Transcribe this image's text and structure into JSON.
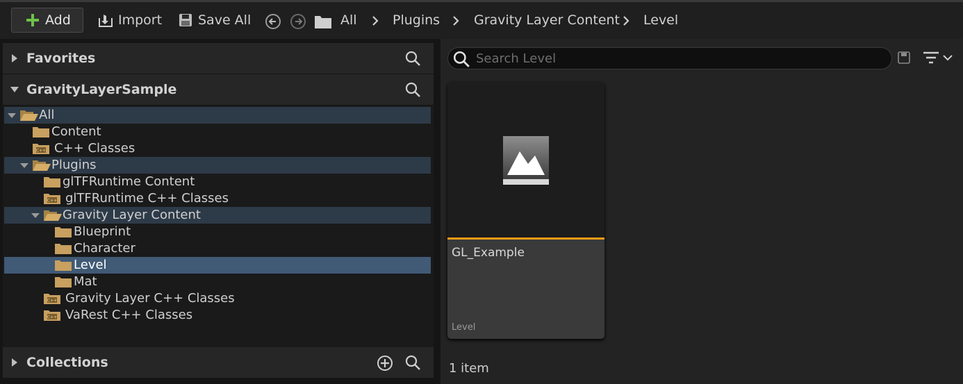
{
  "toolbar": {
    "add_label": "Add",
    "import_label": "Import",
    "save_all_label": "Save All",
    "breadcrumb": [
      "All",
      "Plugins",
      "Gravity Layer Content",
      "Level"
    ]
  },
  "left": {
    "favorites_title": "Favorites",
    "project_title": "GravityLayerSample",
    "collections_title": "Collections",
    "tree": [
      {
        "label": "All",
        "type": "open"
      },
      {
        "label": "Content",
        "type": "folder"
      },
      {
        "label": "C++ Classes",
        "type": "cpp"
      },
      {
        "label": "Plugins",
        "type": "open"
      },
      {
        "label": "glTFRuntime Content",
        "type": "folder"
      },
      {
        "label": "glTFRuntime C++ Classes",
        "type": "cpp"
      },
      {
        "label": "Gravity Layer Content",
        "type": "open"
      },
      {
        "label": "Blueprint",
        "type": "folder"
      },
      {
        "label": "Character",
        "type": "folder"
      },
      {
        "label": "Level",
        "type": "folder"
      },
      {
        "label": "Mat",
        "type": "folder"
      },
      {
        "label": "Gravity Layer C++ Classes",
        "type": "cpp"
      },
      {
        "label": "VaRest C++ Classes",
        "type": "cpp"
      }
    ]
  },
  "right": {
    "search_placeholder": "Search Level",
    "asset": {
      "name": "GL_Example",
      "type": "Level"
    },
    "item_count": "1 item"
  },
  "colors": {
    "accent_bar": "#f39c12",
    "selected_row": "#415a75",
    "folder": "#c8a060"
  }
}
